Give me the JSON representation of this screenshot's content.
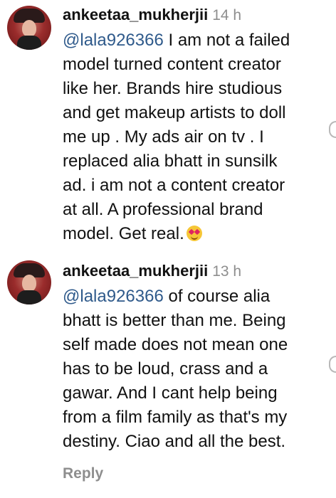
{
  "comments": [
    {
      "username": "ankeetaa_mukherjii",
      "time": "14 h",
      "lines": [
        {
          "mention": "@lala926366",
          "text": " I am not a failed"
        },
        {
          "text": "model turned content creator"
        },
        {
          "text": "like her. Brands hire studious"
        },
        {
          "text": "and get makeup artists to doll"
        },
        {
          "text": "me up . My ads air on tv . I"
        },
        {
          "text": "replaced alia bhatt in sunsilk"
        },
        {
          "text": "ad. i am not a content creator"
        },
        {
          "text": "at all. A professional brand"
        },
        {
          "text": "model. Get real.",
          "emoji": "heart-eyes-emoji"
        }
      ]
    },
    {
      "username": "ankeetaa_mukherjii",
      "time": "13 h",
      "lines": [
        {
          "mention": "@lala926366",
          "text": " of course alia"
        },
        {
          "text": "bhatt is better than me. Being"
        },
        {
          "text": "self made does not mean one"
        },
        {
          "text": "has to be loud, crass and a"
        },
        {
          "text": "gawar. And I cant help being"
        },
        {
          "text": "from a film family as that's my"
        },
        {
          "text": "destiny. Ciao and all the best."
        }
      ]
    }
  ],
  "reply_label": "Reply",
  "colors": {
    "mention": "#2f5a8b",
    "meta": "#8e8e8e",
    "text": "#111111"
  }
}
